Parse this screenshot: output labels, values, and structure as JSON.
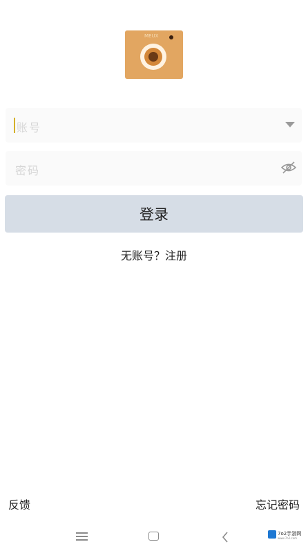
{
  "logo": {
    "icon": "camera-app-logo",
    "text": "MEUX",
    "color": "#e2a661"
  },
  "form": {
    "account_placeholder": "账号",
    "password_placeholder": "密码",
    "account_dropdown_icon": "chevron-down-icon",
    "password_visibility_icon": "eye-off-icon"
  },
  "login": {
    "label": "登录",
    "background": "#d6dde6"
  },
  "register": {
    "label": "无账号？注册"
  },
  "footer": {
    "feedback": "反馈",
    "forgot_password": "忘记密码"
  },
  "navbar": {
    "menu_icon": "menu-icon",
    "home_icon": "home-icon",
    "back_icon": "back-icon"
  },
  "watermark": {
    "text": "7o2手游网",
    "sub": "www.7o2.com"
  }
}
